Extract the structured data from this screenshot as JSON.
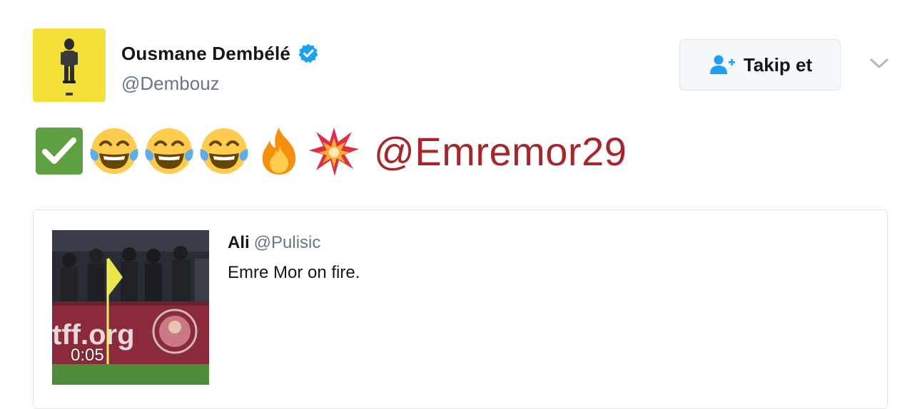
{
  "header": {
    "display_name": "Ousmane Dembélé",
    "handle": "@Dembouz",
    "verified": true,
    "verified_color": "#1da1f2",
    "avatar_background": "#f3e13a"
  },
  "follow_button": {
    "label": "Takip et",
    "icon": "add-user-icon",
    "icon_color": "#1da1f2"
  },
  "menu": {
    "icon": "chevron-down-icon"
  },
  "tweet": {
    "emojis": [
      "check-mark-button-emoji",
      "face-with-tears-of-joy-emoji",
      "face-with-tears-of-joy-emoji",
      "face-with-tears-of-joy-emoji",
      "fire-emoji",
      "collision-emoji"
    ],
    "mention": "@Emremor29",
    "mention_color": "#a8262b"
  },
  "quoted_tweet": {
    "name": "Ali",
    "handle": "@Pulisic",
    "text": "Emre Mor on fire.",
    "video_duration": "0:05",
    "media_banner_text": "tff.org"
  }
}
